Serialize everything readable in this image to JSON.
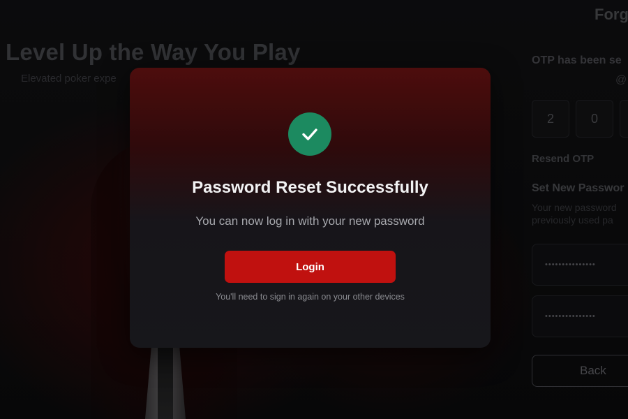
{
  "background": {
    "hero": {
      "title": "Level Up the Way You Play",
      "subtitle": "Elevated poker expe"
    },
    "form": {
      "title": "Forg",
      "otp_sent": "OTP has been se",
      "otp_email": "@",
      "otp_digits": [
        "2",
        "0",
        ""
      ],
      "resend_label": "Resend OTP",
      "set_new_label": "Set New Passwor",
      "hint_lines": [
        "Your new password",
        "previously used pa"
      ],
      "password_mask": "•••••••••••••••",
      "confirm_mask": "•••••••••••••••",
      "back_label": "Back"
    }
  },
  "modal": {
    "icon": "check-icon",
    "title": "Password Reset Successfully",
    "subtitle": "You can now log in with your new password",
    "login_label": "Login",
    "note": "You'll need to sign in again on your other devices"
  },
  "colors": {
    "accent_red": "#c0110f",
    "success_green": "#1c8a60",
    "modal_top": "#4d0d0d",
    "modal_bottom": "#17171b"
  }
}
